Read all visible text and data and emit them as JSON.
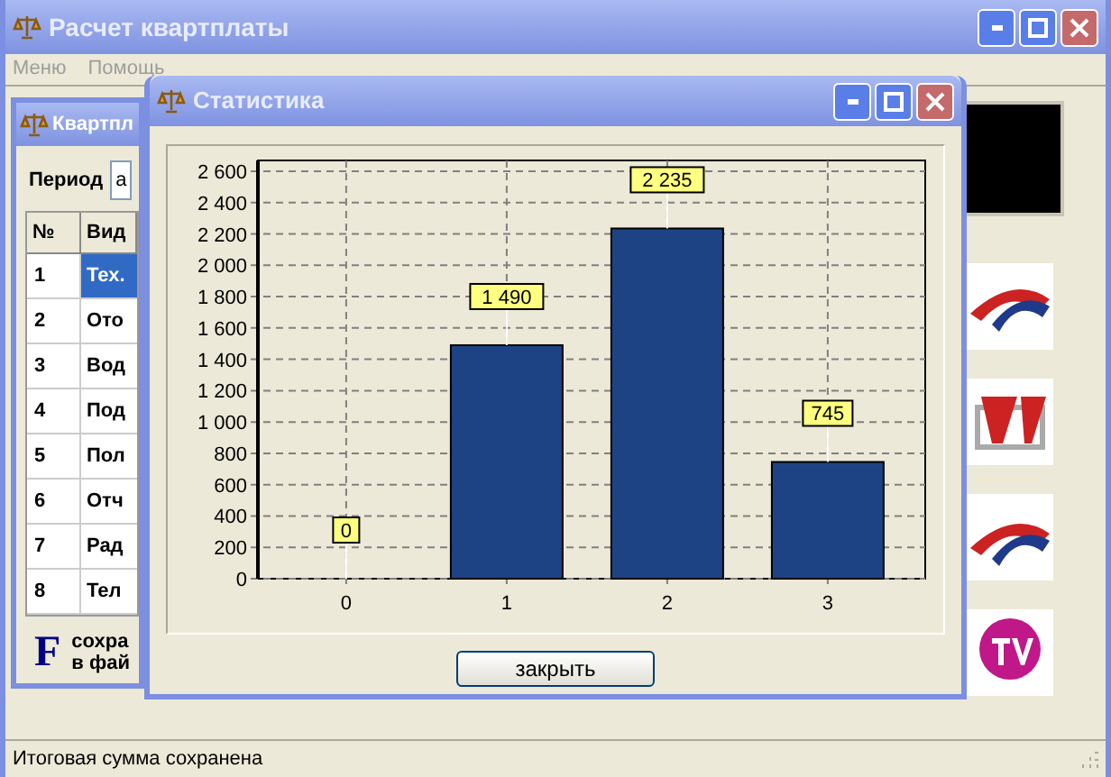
{
  "window": {
    "title": "Расчет квартплаты"
  },
  "menu": [
    {
      "label": "Меню",
      "disabled": true
    },
    {
      "label": "Помощь",
      "disabled": true
    }
  ],
  "tenant_window": {
    "title": "Квартпл",
    "period_label": "Период",
    "period_value": "а",
    "columns": [
      "№",
      "Вид"
    ],
    "rows": [
      {
        "number": "1",
        "type": "Тех.",
        "selected": true
      },
      {
        "number": "2",
        "type": "Ото",
        "selected": false
      },
      {
        "number": "3",
        "type": "Вод",
        "selected": false
      },
      {
        "number": "4",
        "type": "Под",
        "selected": false
      },
      {
        "number": "5",
        "type": "Пол",
        "selected": false
      },
      {
        "number": "6",
        "type": "Отч",
        "selected": false
      },
      {
        "number": "7",
        "type": "Рад",
        "selected": false
      },
      {
        "number": "8",
        "type": "Тел",
        "selected": false
      }
    ],
    "footer_icon": "F",
    "footer_lines": [
      "сохра",
      "в фай"
    ]
  },
  "statistics_window": {
    "title": "Статистика",
    "close_button": "закрыть",
    "chart_data": {
      "type": "bar",
      "grid": true,
      "categories": [
        "0",
        "1",
        "2",
        "3"
      ],
      "values": [
        0,
        1490,
        2235,
        745
      ],
      "ylim": [
        0,
        2600
      ],
      "yticks": [
        0,
        200,
        400,
        600,
        800,
        {
          "value": 1000,
          "label": "1 000"
        },
        {
          "value": 1200,
          "label": "1 200"
        },
        {
          "value": 1400,
          "label": "1 400"
        },
        {
          "value": 1600,
          "label": "1 600"
        },
        {
          "value": 1800,
          "label": "1 800"
        },
        {
          "value": 2000,
          "label": "2 000"
        },
        {
          "value": 2200,
          "label": "2 200"
        },
        {
          "value": 2400,
          "label": "2 400"
        },
        {
          "value": 2600,
          "label": "2 600"
        }
      ],
      "value_labels": [
        "0",
        "1 490",
        "2 235",
        "745"
      ]
    }
  },
  "status_bar": {
    "text": "Итоговая сумма сохранена"
  }
}
